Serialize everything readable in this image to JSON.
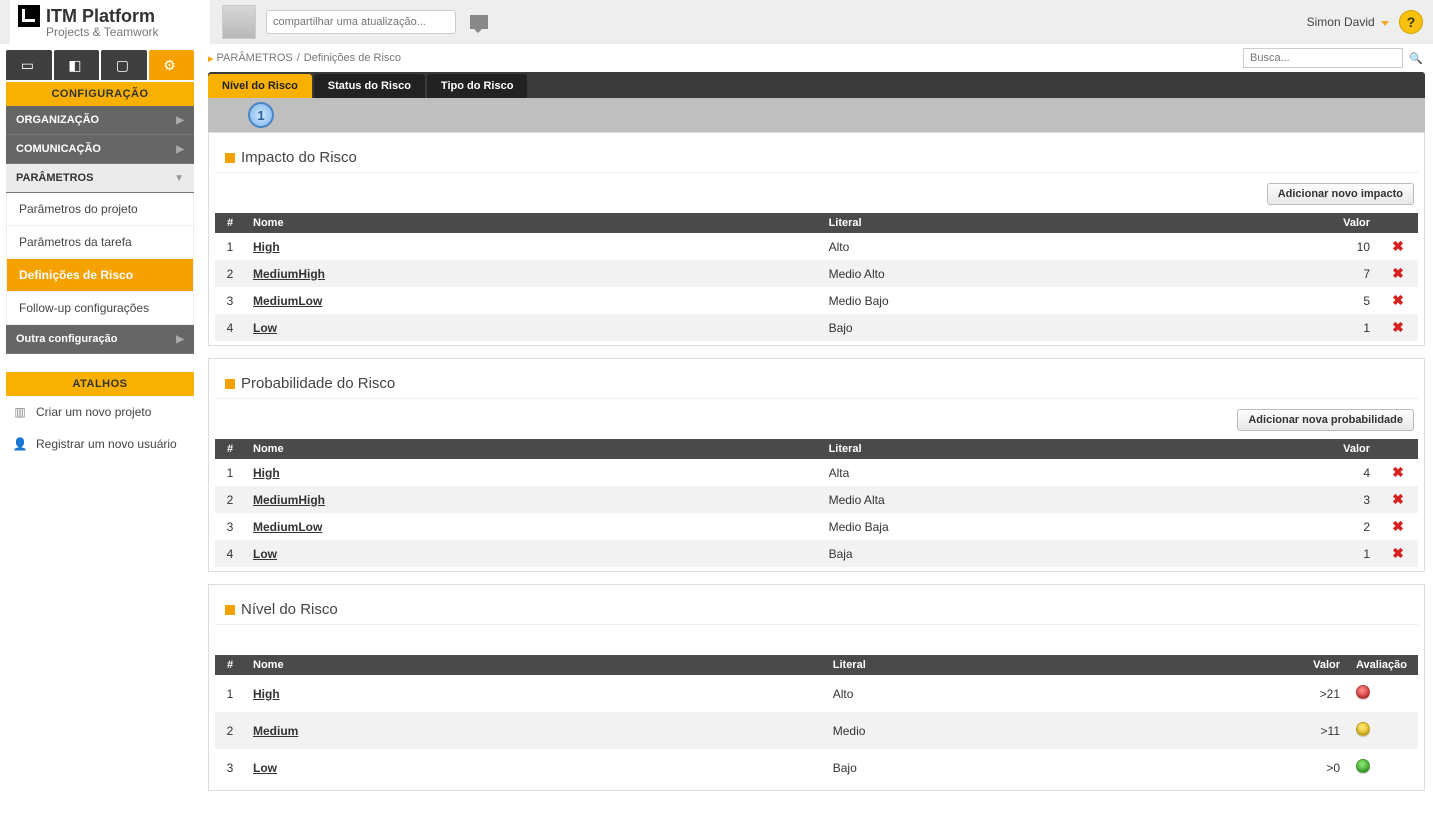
{
  "brand": {
    "name": "ITM Platform",
    "subtitle": "Projects & Teamwork"
  },
  "topbar": {
    "share_placeholder": "compartilhar uma atualização...",
    "user": "Simon David",
    "help": "?"
  },
  "breadcrumb": {
    "root": "PARÂMETROS",
    "current": "Definições de Risco"
  },
  "search": {
    "placeholder": "Busca..."
  },
  "tabs": {
    "t1": "Nível do Risco",
    "t2": "Status do Risco",
    "t3": "Tipo do Risco"
  },
  "stepper": {
    "num": "1"
  },
  "sidebar": {
    "config": "CONFIGURAÇÃO",
    "org": "ORGANIZAÇÃO",
    "com": "COMUNICAÇÃO",
    "param": "PARÂMETROS",
    "sub": {
      "proj": "Parâmetros do projeto",
      "tarefa": "Parâmetros da tarefa",
      "risco": "Definições de Risco",
      "follow": "Follow-up configurações"
    },
    "other": "Outra configuração",
    "atalhos": "ATALHOS",
    "sc1": "Criar um novo projeto",
    "sc2": "Registrar um novo usuário"
  },
  "cols": {
    "idx": "#",
    "nome": "Nome",
    "literal": "Literal",
    "valor": "Valor",
    "aval": "Avaliação"
  },
  "impact": {
    "title": "Impacto do Risco",
    "add": "Adicionar novo impacto",
    "rows": [
      {
        "i": "1",
        "name": "High",
        "literal": "Alto",
        "valor": "10"
      },
      {
        "i": "2",
        "name": "MediumHigh",
        "literal": "Medio Alto",
        "valor": "7"
      },
      {
        "i": "3",
        "name": "MediumLow",
        "literal": "Medio Bajo",
        "valor": "5"
      },
      {
        "i": "4",
        "name": "Low",
        "literal": "Bajo",
        "valor": "1"
      }
    ]
  },
  "prob": {
    "title": "Probabilidade do Risco",
    "add": "Adicionar nova probabilidade",
    "rows": [
      {
        "i": "1",
        "name": "High",
        "literal": "Alta",
        "valor": "4"
      },
      {
        "i": "2",
        "name": "MediumHigh",
        "literal": "Medio Alta",
        "valor": "3"
      },
      {
        "i": "3",
        "name": "MediumLow",
        "literal": "Medio Baja",
        "valor": "2"
      },
      {
        "i": "4",
        "name": "Low",
        "literal": "Baja",
        "valor": "1"
      }
    ]
  },
  "level": {
    "title": "Nível do Risco",
    "rows": [
      {
        "i": "1",
        "name": "High",
        "literal": "Alto",
        "valor": ">21",
        "color": "red"
      },
      {
        "i": "2",
        "name": "Medium",
        "literal": "Medio",
        "valor": ">11",
        "color": "yellow"
      },
      {
        "i": "3",
        "name": "Low",
        "literal": "Bajo",
        "valor": ">0",
        "color": "green"
      }
    ]
  }
}
